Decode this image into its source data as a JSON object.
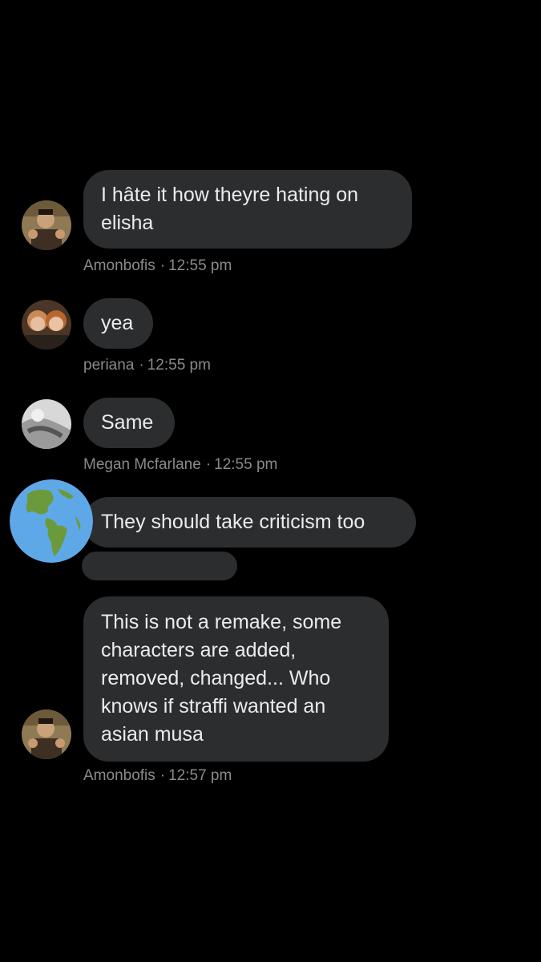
{
  "messages": [
    {
      "author": "Amonbofis",
      "time": "12:55 pm",
      "text": "I hâte it how theyre hating on elisha"
    },
    {
      "author": "periana",
      "time": "12:55 pm",
      "text": "yea"
    },
    {
      "author": "Megan Mcfarlane",
      "time": "12:55 pm",
      "text": "Same"
    },
    {
      "author": "",
      "time": "",
      "text": "They should take criticism too"
    },
    {
      "author": "Amonbofis",
      "time": "12:57 pm",
      "text": "This is not a remake, some characters are added, removed, changed... Who knows if straffi wanted an asian musa"
    }
  ],
  "meta_separator": "·",
  "colors": {
    "background": "#000000",
    "bubble": "#2c2d2f",
    "text": "#ececec",
    "meta_text": "#8a8a8e"
  },
  "icons": {
    "globe": "globe-americas-icon"
  }
}
